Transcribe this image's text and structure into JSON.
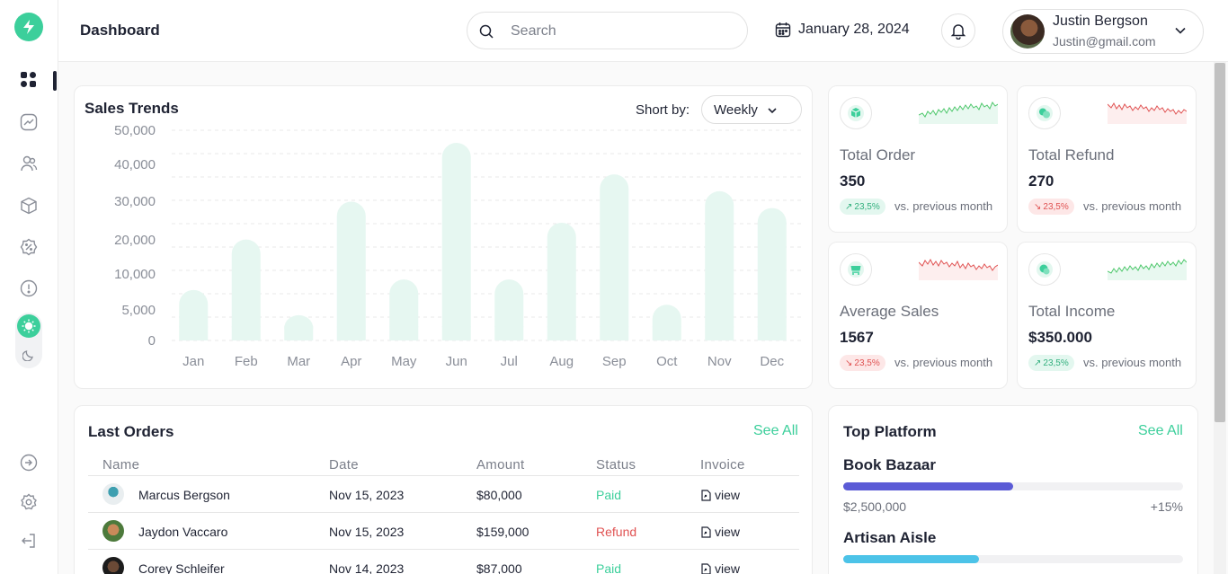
{
  "header": {
    "title": "Dashboard",
    "search_placeholder": "Search",
    "date": "January 28, 2024",
    "user": {
      "name": "Justin Bergson",
      "email": "Justin@gmail.com"
    }
  },
  "sidebar": {
    "items": [
      "dashboard-icon",
      "analytics-icon",
      "users-icon",
      "box-icon",
      "discount-icon",
      "info-icon"
    ],
    "bottom_items": [
      "login-icon",
      "settings-icon",
      "logout-icon"
    ],
    "theme": "light"
  },
  "sales": {
    "title": "Sales Trends",
    "sort_label": "Short by:",
    "sort_value": "Weekly"
  },
  "chart_data": {
    "type": "bar",
    "title": "Sales Trends",
    "categories": [
      "Jan",
      "Feb",
      "Mar",
      "Apr",
      "May",
      "Jun",
      "Jul",
      "Aug",
      "Sep",
      "Oct",
      "Nov",
      "Dec"
    ],
    "values": [
      12000,
      24000,
      6000,
      33000,
      14500,
      47000,
      14500,
      28000,
      39500,
      8500,
      35500,
      31500
    ],
    "ytick_labels": [
      "0",
      "5,000",
      "10,000",
      "20,000",
      "30,000",
      "40,000",
      "50,000"
    ],
    "ylim": [
      0,
      50000
    ],
    "bar_color": "#e6f7f1",
    "grid": true
  },
  "stats": [
    {
      "label": "Total Order",
      "value": "350",
      "change": "23,5%",
      "trend": "up",
      "vs": "vs. previous month",
      "icon": "cube-icon"
    },
    {
      "label": "Total Refund",
      "value": "270",
      "change": "23,5%",
      "trend": "down",
      "vs": "vs. previous month",
      "icon": "refund-icon"
    },
    {
      "label": "Average Sales",
      "value": "1567",
      "change": "23,5%",
      "trend": "down",
      "vs": "vs. previous month",
      "icon": "cart-icon"
    },
    {
      "label": "Total Income",
      "value": "$350.000",
      "change": "23,5%",
      "trend": "up",
      "vs": "vs. previous month",
      "icon": "coins-icon"
    }
  ],
  "orders": {
    "title": "Last Orders",
    "see_all": "See All",
    "columns": [
      "Name",
      "Date",
      "Amount",
      "Status",
      "Invoice"
    ],
    "rows": [
      {
        "name": "Marcus Bergson",
        "date": "Nov 15, 2023",
        "amount": "$80,000",
        "status": "Paid",
        "invoice": "view"
      },
      {
        "name": "Jaydon Vaccaro",
        "date": "Nov 15, 2023",
        "amount": "$159,000",
        "status": "Refund",
        "invoice": "view"
      },
      {
        "name": "Corey Schleifer",
        "date": "Nov 14, 2023",
        "amount": "$87,000",
        "status": "Paid",
        "invoice": "view"
      }
    ]
  },
  "platform": {
    "title": "Top Platform",
    "see_all": "See All",
    "items": [
      {
        "name": "Book Bazaar",
        "amount": "$2,500,000",
        "pct": "+15%",
        "progress": 0.5,
        "color": "#5b5bd6"
      },
      {
        "name": "Artisan Aisle",
        "amount": "",
        "pct": "",
        "progress": 0.4,
        "color": "#4cc3e8"
      }
    ]
  },
  "colors": {
    "accent": "#3ccf9b",
    "danger": "#e05252",
    "brand_blue": "#5b5bd6"
  }
}
